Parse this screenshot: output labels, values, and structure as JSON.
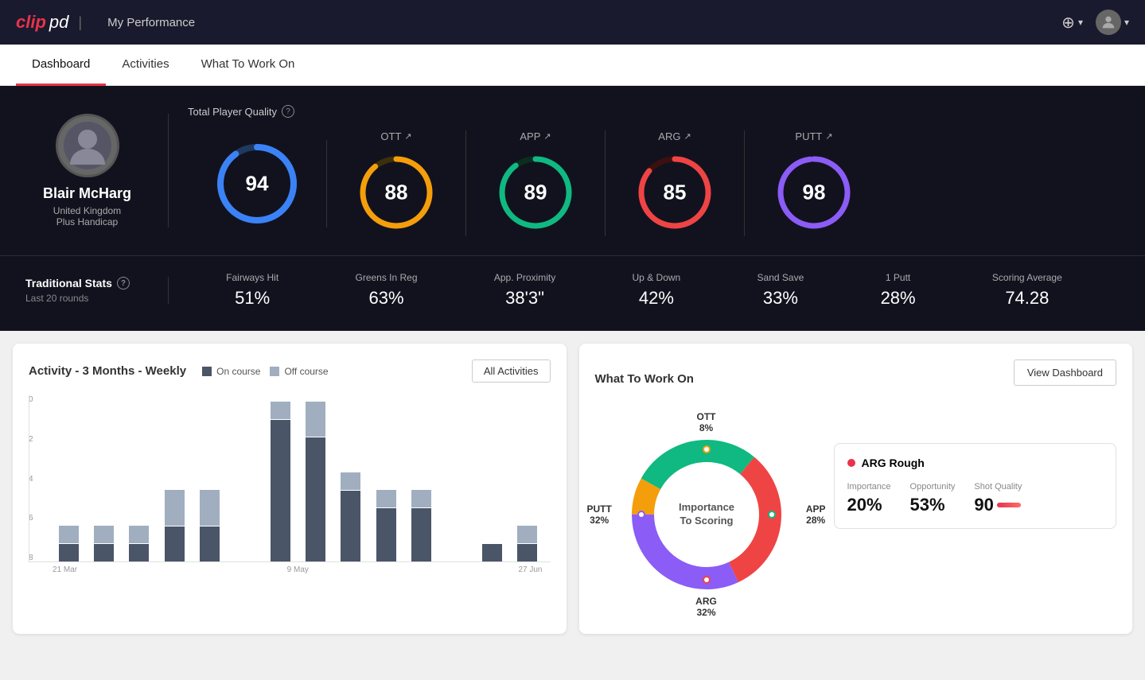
{
  "header": {
    "logo_clip": "clip",
    "logo_pd": "pd",
    "title": "My Performance",
    "add_icon": "⊕",
    "dropdown_icon": "▾",
    "avatar_icon": "👤"
  },
  "nav": {
    "tabs": [
      {
        "label": "Dashboard",
        "active": true
      },
      {
        "label": "Activities",
        "active": false
      },
      {
        "label": "What To Work On",
        "active": false
      }
    ]
  },
  "player": {
    "name": "Blair McHarg",
    "country": "United Kingdom",
    "handicap": "Plus Handicap"
  },
  "scores": {
    "tpq_label": "Total Player Quality",
    "main": {
      "value": "94",
      "color": "#3b82f6",
      "trail_color": "#1e3a5f"
    },
    "categories": [
      {
        "label": "OTT",
        "value": "88",
        "color": "#f59e0b",
        "trail_color": "#3d2f0a"
      },
      {
        "label": "APP",
        "value": "89",
        "color": "#10b981",
        "trail_color": "#0a2e1e"
      },
      {
        "label": "ARG",
        "value": "85",
        "color": "#ef4444",
        "trail_color": "#3d0f0f"
      },
      {
        "label": "PUTT",
        "value": "98",
        "color": "#8b5cf6",
        "trail_color": "#2d1a4a"
      }
    ]
  },
  "traditional_stats": {
    "title": "Traditional Stats",
    "subtitle": "Last 20 rounds",
    "items": [
      {
        "label": "Fairways Hit",
        "value": "51%"
      },
      {
        "label": "Greens In Reg",
        "value": "63%"
      },
      {
        "label": "App. Proximity",
        "value": "38'3\""
      },
      {
        "label": "Up & Down",
        "value": "42%"
      },
      {
        "label": "Sand Save",
        "value": "33%"
      },
      {
        "label": "1 Putt",
        "value": "28%"
      },
      {
        "label": "Scoring Average",
        "value": "74.28"
      }
    ]
  },
  "activity_chart": {
    "title": "Activity - 3 Months - Weekly",
    "legend": [
      {
        "label": "On course",
        "color": "#4a5568"
      },
      {
        "label": "Off course",
        "color": "#a0aec0"
      }
    ],
    "all_activities_btn": "All Activities",
    "y_labels": [
      "0",
      "2",
      "4",
      "6",
      "8"
    ],
    "x_labels": [
      "21 Mar",
      "9 May",
      "27 Jun"
    ],
    "bars": [
      {
        "dark": 1,
        "light": 1
      },
      {
        "dark": 1,
        "light": 1
      },
      {
        "dark": 1,
        "light": 1
      },
      {
        "dark": 2,
        "light": 2
      },
      {
        "dark": 2,
        "light": 2
      },
      {
        "dark": 0,
        "light": 0
      },
      {
        "dark": 8,
        "light": 1
      },
      {
        "dark": 7,
        "light": 2
      },
      {
        "dark": 4,
        "light": 1
      },
      {
        "dark": 3,
        "light": 1
      },
      {
        "dark": 3,
        "light": 1
      },
      {
        "dark": 0,
        "light": 0
      },
      {
        "dark": 1,
        "light": 0
      },
      {
        "dark": 1,
        "light": 1
      }
    ],
    "max_value": 9
  },
  "what_to_work_on": {
    "title": "What To Work On",
    "view_dashboard_btn": "View Dashboard",
    "donut": {
      "center_line1": "Importance",
      "center_line2": "To Scoring",
      "segments": [
        {
          "label": "OTT\n8%",
          "color": "#f59e0b",
          "pct": 8,
          "position": "top"
        },
        {
          "label": "APP\n28%",
          "color": "#10b981",
          "pct": 28,
          "position": "right"
        },
        {
          "label": "ARG\n32%",
          "color": "#ef4444",
          "pct": 32,
          "position": "bottom"
        },
        {
          "label": "PUTT\n32%",
          "color": "#8b5cf6",
          "pct": 32,
          "position": "left"
        }
      ]
    },
    "detail_card": {
      "category": "ARG Rough",
      "dot_color": "#ef4444",
      "stats": [
        {
          "label": "Importance",
          "value": "20%"
        },
        {
          "label": "Opportunity",
          "value": "53%"
        },
        {
          "label": "Shot Quality",
          "value": "90"
        }
      ]
    }
  }
}
